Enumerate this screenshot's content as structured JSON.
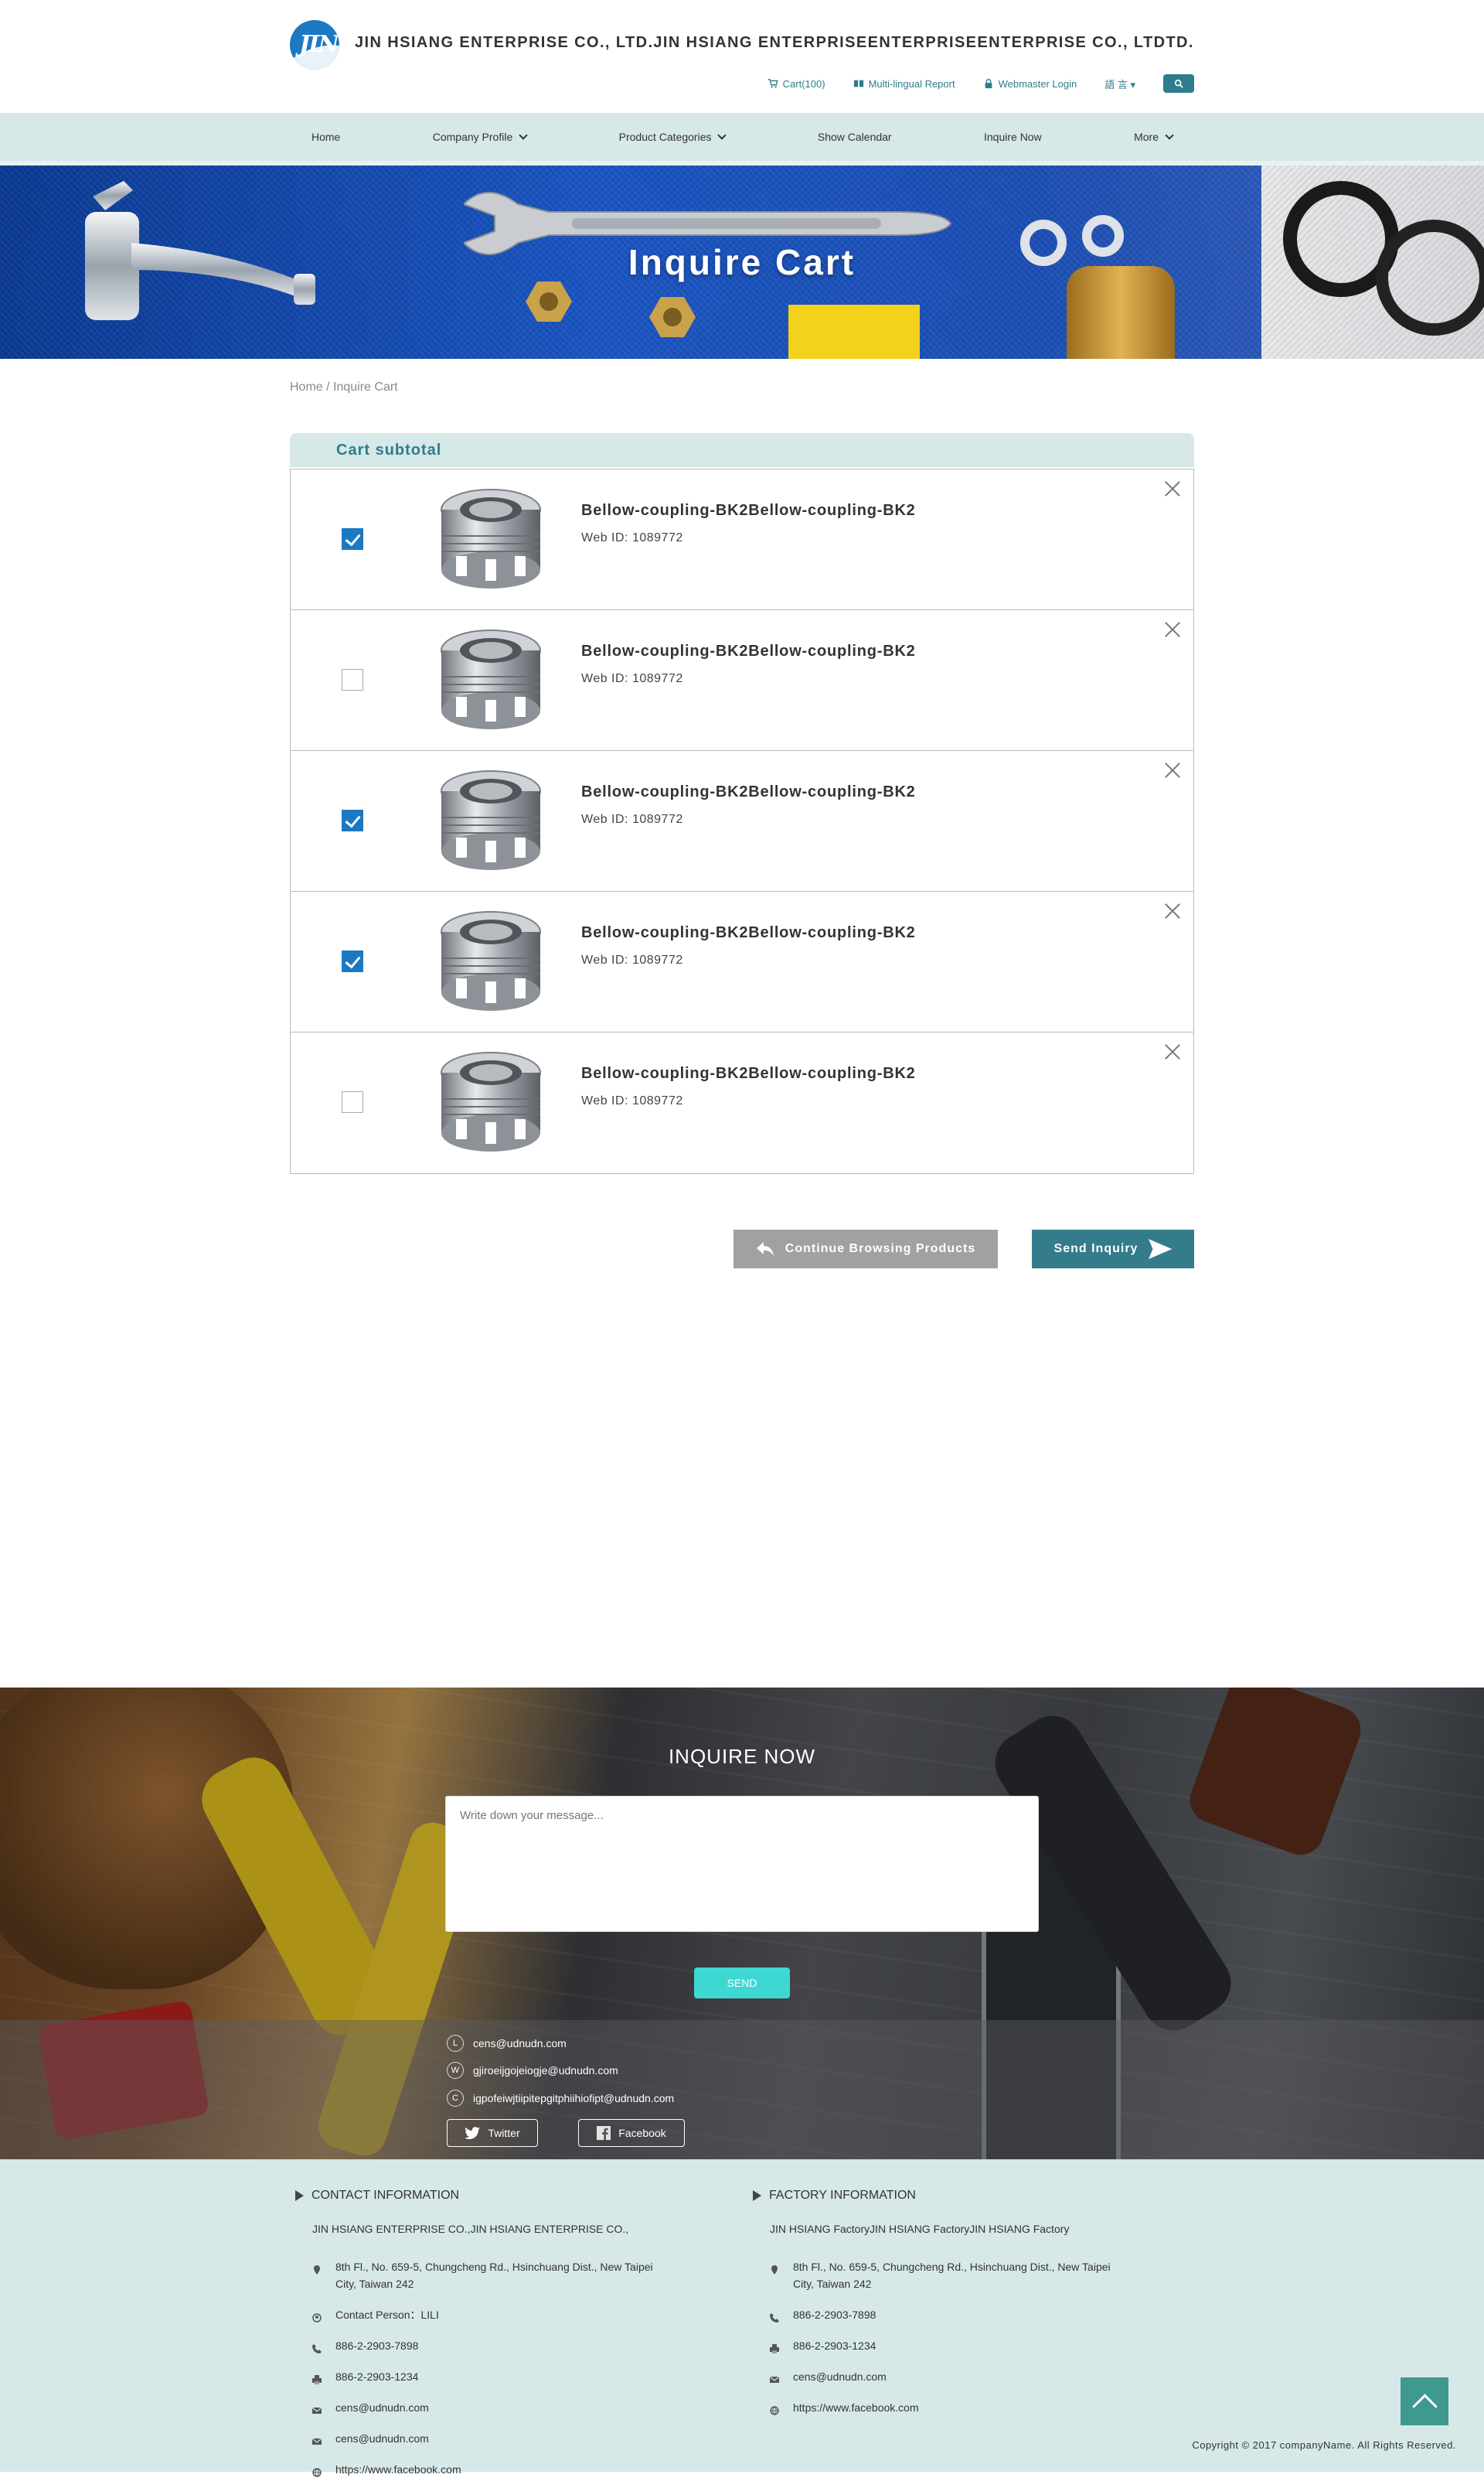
{
  "header": {
    "company": "JIN HSIANG ENTERPRISE CO., LTD.JIN HSIANG ENTERPRISEENTERPRISEENTERPRISE CO., LTDTD.",
    "logo_text": "JIN",
    "cart": "Cart(100)",
    "report": "Multi-lingual Report",
    "login": "Webmaster Login",
    "language": "語 言 ▾"
  },
  "nav": {
    "items": [
      "Home",
      "Company Profile",
      "Product Categories",
      "Show Calendar",
      "Inquire Now",
      "More"
    ]
  },
  "banner": {
    "title": "Inquire Cart"
  },
  "breadcrumb": "Home / Inquire Cart",
  "cart": {
    "header": "Cart subtotal",
    "items": [
      {
        "name": "Bellow-coupling-BK2Bellow-coupling-BK2",
        "web_id": "Web ID: 1089772",
        "checked": true
      },
      {
        "name": "Bellow-coupling-BK2Bellow-coupling-BK2",
        "web_id": "Web ID: 1089772",
        "checked": false
      },
      {
        "name": "Bellow-coupling-BK2Bellow-coupling-BK2",
        "web_id": "Web ID: 1089772",
        "checked": true
      },
      {
        "name": "Bellow-coupling-BK2Bellow-coupling-BK2",
        "web_id": "Web ID: 1089772",
        "checked": true
      },
      {
        "name": "Bellow-coupling-BK2Bellow-coupling-BK2",
        "web_id": "Web ID: 1089772",
        "checked": false
      }
    ],
    "continue_label": "Continue Browsing Products",
    "send_label": "Send Inquiry"
  },
  "inquire": {
    "title": "INQUIRE NOW",
    "placeholder": "Write down your message...",
    "send": "SEND",
    "line": "cens@udnudn.com",
    "whatsapp": "gjiroeijgojeiogje@udnudn.com",
    "wechat": "igpofeiwjtiipitepgitphiihiofipt@udnudn.com",
    "twitter": "Twitter",
    "facebook": "Facebook"
  },
  "footer": {
    "contact": {
      "title": "CONTACT INFORMATION",
      "name": "JIN HSIANG ENTERPRISE CO.,JIN HSIANG ENTERPRISE CO.,",
      "address": "8th Fl., No. 659-5, Chungcheng Rd., Hsinchuang Dist., New Taipei City, Taiwan 242",
      "person": "Contact Person：LILI",
      "tel": "886-2-2903-7898",
      "fax": "886-2-2903-1234",
      "email1": "cens@udnudn.com",
      "email2": "cens@udnudn.com",
      "web": "https://www.facebook.com"
    },
    "factory": {
      "title": "FACTORY INFORMATION",
      "name": "JIN HSIANG FactoryJIN HSIANG FactoryJIN HSIANG Factory",
      "address": "8th Fl., No. 659-5, Chungcheng Rd., Hsinchuang Dist., New Taipei City, Taiwan 242",
      "tel": "886-2-2903-7898",
      "fax": "886-2-2903-1234",
      "email": "cens@udnudn.com",
      "web": "https://www.facebook.com"
    },
    "copyright": "Copyright © 2017 companyName. All Rights Reserved."
  },
  "colors": {
    "accent": "#2e7d8c",
    "nav_bg": "#d6e8e8",
    "checkbox": "#1b78c2",
    "send": "#3ed8d2"
  }
}
